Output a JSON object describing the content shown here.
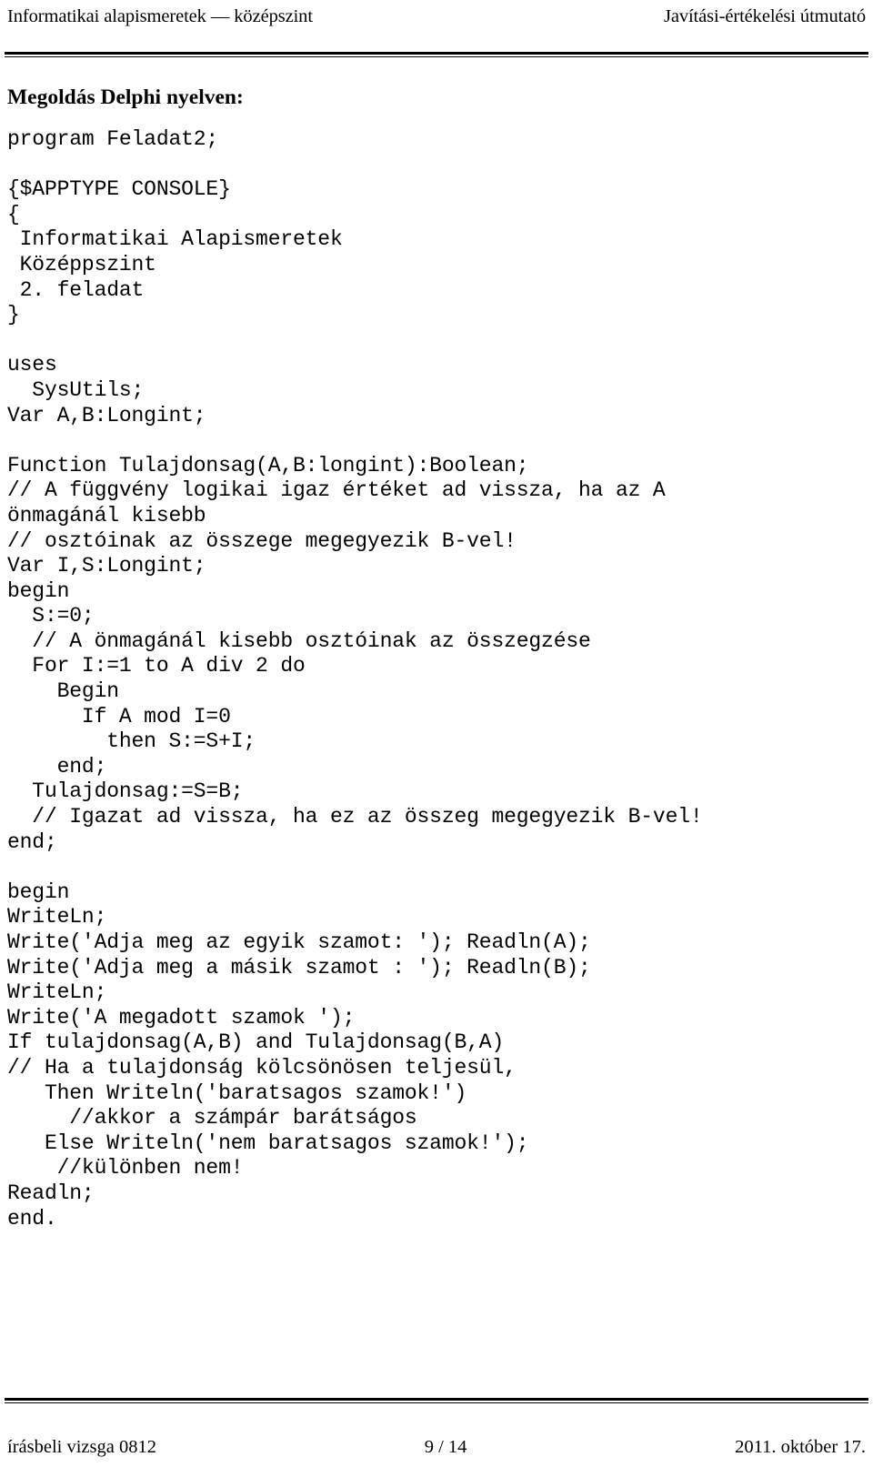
{
  "header": {
    "left": "Informatikai alapismeretek — középszint",
    "right": "Javítási-értékelési útmutató"
  },
  "content": {
    "section_title": "Megoldás Delphi nyelven:",
    "code_lines": [
      "program Feladat2;",
      "",
      "{$APPTYPE CONSOLE}",
      "{",
      " Informatikai Alapismeretek",
      " Középpszint",
      " 2. feladat",
      "}",
      "",
      "uses",
      "  SysUtils;",
      "Var A,B:Longint;",
      "",
      "Function Tulajdonsag(A,B:longint):Boolean;",
      "// A függvény logikai igaz értéket ad vissza, ha az A",
      "önmagánál kisebb",
      "// osztóinak az összege megegyezik B-vel!",
      "Var I,S:Longint;",
      "begin",
      "  S:=0;",
      "  // A önmagánál kisebb osztóinak az összegzése",
      "  For I:=1 to A div 2 do",
      "    Begin",
      "      If A mod I=0",
      "        then S:=S+I;",
      "    end;",
      "  Tulajdonsag:=S=B;",
      "  // Igazat ad vissza, ha ez az összeg megegyezik B-vel!",
      "end;",
      "",
      "begin",
      "WriteLn;",
      "Write('Adja meg az egyik szamot: '); Readln(A);",
      "Write('Adja meg a másik szamot : '); Readln(B);",
      "WriteLn;",
      "Write('A megadott szamok ');",
      "If tulajdonsag(A,B) and Tulajdonsag(B,A)",
      "// Ha a tulajdonság kölcsönösen teljesül,",
      "   Then Writeln('baratsagos szamok!')",
      "     //akkor a számpár barátságos",
      "   Else Writeln('nem baratsagos szamok!');",
      "    //különben nem!",
      "Readln;",
      "end."
    ]
  },
  "footer": {
    "left": "írásbeli vizsga 0812",
    "center": "9 / 14",
    "right": "2011. október 17."
  }
}
